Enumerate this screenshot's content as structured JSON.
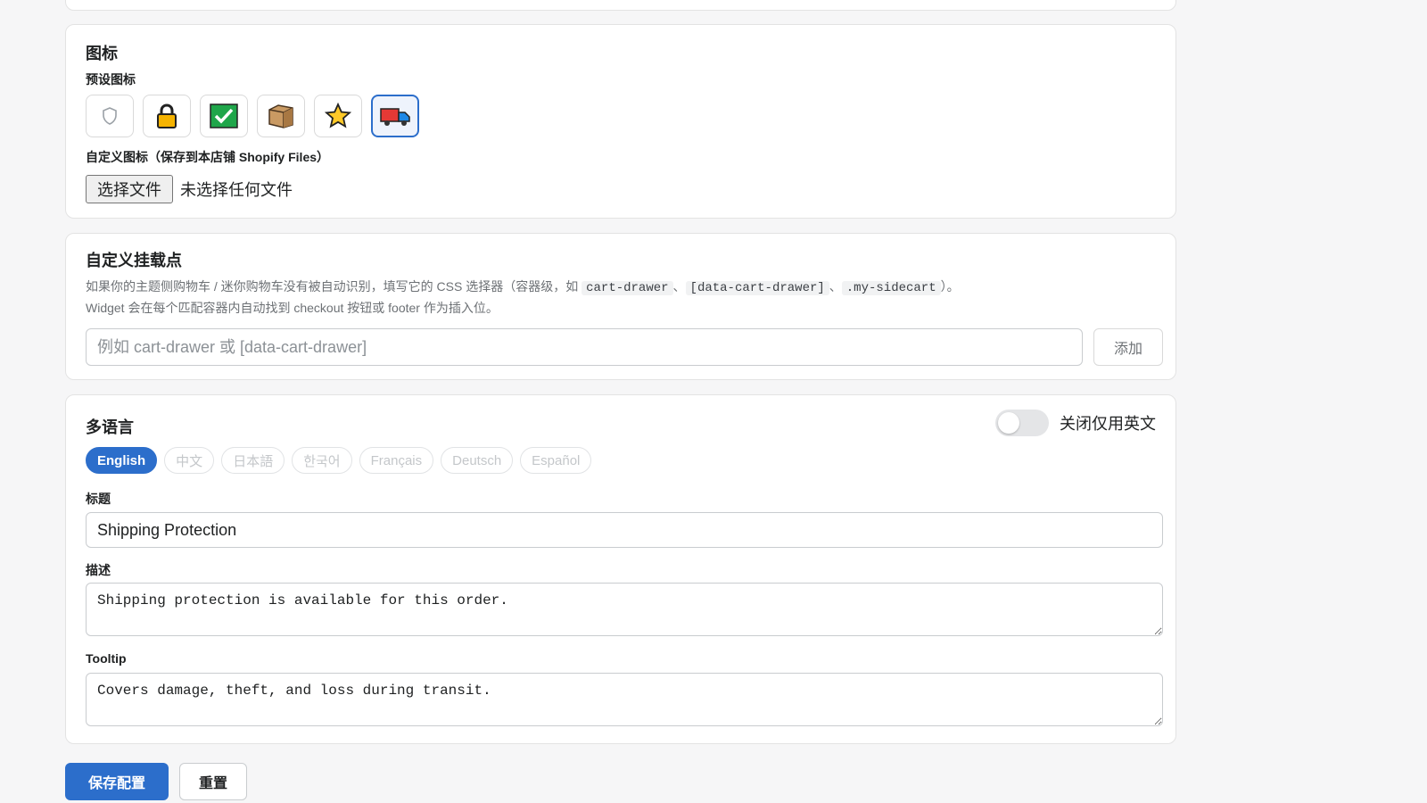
{
  "icons": {
    "title": "图标",
    "preset_label": "预设图标",
    "options": [
      {
        "name": "shield-icon"
      },
      {
        "name": "lock-icon"
      },
      {
        "name": "checkmark-icon"
      },
      {
        "name": "box-icon"
      },
      {
        "name": "star-icon"
      },
      {
        "name": "truck-icon"
      }
    ],
    "selected": "truck-icon",
    "custom_label": "自定义图标（保存到本店铺 Shopify Files）",
    "file_button": "选择文件",
    "file_status": "未选择任何文件"
  },
  "mount": {
    "title": "自定义挂载点",
    "desc_prefix": "如果你的主题侧购物车 / 迷你购物车没有被自动识别，填写它的 CSS 选择器（容器级，如",
    "code1": "cart-drawer",
    "sep1": "、",
    "code2": "[data-cart-drawer]",
    "sep2": "、",
    "code3": ".my-sidecart",
    "desc_suffix": "）。",
    "desc_line2": "Widget 会在每个匹配容器内自动找到 checkout 按钮或 footer 作为插入位。",
    "input_placeholder": "例如 cart-drawer 或 [data-cart-drawer]",
    "add_button": "添加"
  },
  "languages": {
    "title": "多语言",
    "toggle_label": "关闭仅用英文",
    "toggle_on": false,
    "tabs": [
      "English",
      "中文",
      "日本語",
      "한국어",
      "Français",
      "Deutsch",
      "Español"
    ],
    "active_tab": "English",
    "title_label": "标题",
    "title_value": "Shipping Protection",
    "desc_label": "描述",
    "desc_value": "Shipping protection is available for this order.",
    "tooltip_label": "Tooltip",
    "tooltip_value": "Covers damage, theft, and loss during transit."
  },
  "actions": {
    "save": "保存配置",
    "reset": "重置"
  },
  "colors": {
    "accent": "#2c6ecb",
    "background": "#f6f6f7"
  }
}
